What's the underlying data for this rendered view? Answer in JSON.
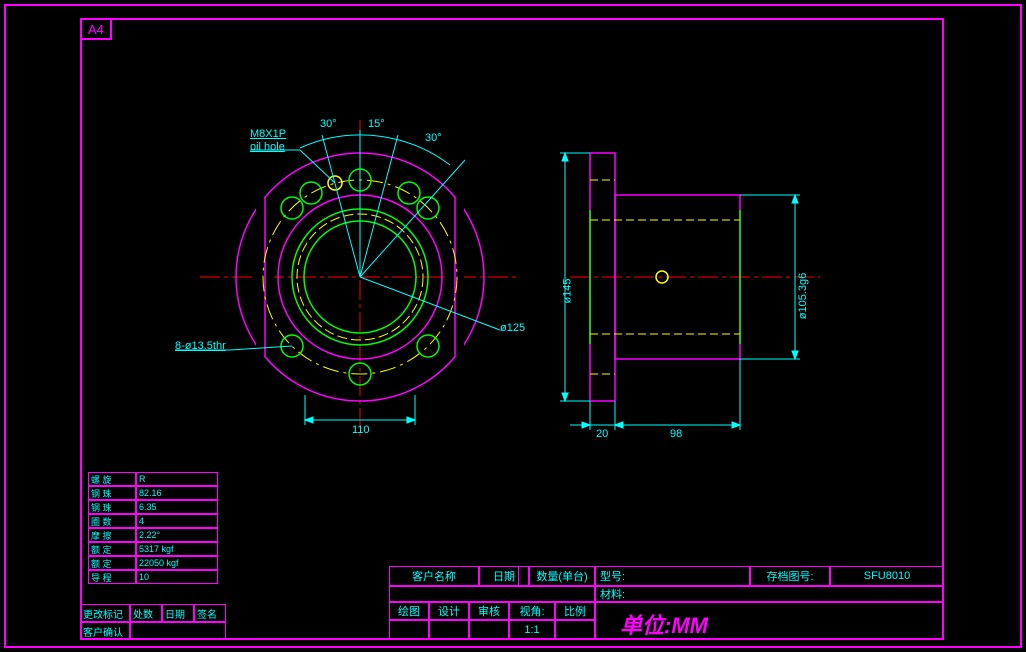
{
  "sheet_size": "A4",
  "drawing": {
    "oil_hole": "M8X1P",
    "oil_hole_label": "oil hole",
    "angles": {
      "a1": "30°",
      "a2": "15°",
      "a3": "30°"
    },
    "hole_callout": "8-ø13.5thr",
    "diam_bolt_circle": "ø125",
    "front_dims": {
      "width": "110"
    },
    "side_dims": {
      "height": "ø145",
      "outer_dia": "ø105.3g6",
      "flange": "20",
      "body": "98"
    }
  },
  "params": {
    "rows": [
      [
        "螺 旋",
        "R"
      ],
      [
        "钢 珠",
        "82.16"
      ],
      [
        "钢 珠",
        "6.35"
      ],
      [
        "圈 数",
        "4"
      ],
      [
        "摩 擦",
        "2.22°"
      ],
      [
        "额 定",
        "5317 kgf"
      ],
      [
        "额 定",
        "22050 kgf"
      ],
      [
        "导 程",
        "10"
      ]
    ]
  },
  "revision": {
    "h1": "更改标记",
    "h2": "处数",
    "h3": "日期",
    "h4": "签名",
    "h5": "客户确认"
  },
  "title_block": {
    "r1": [
      "客户名称",
      "",
      "日期",
      "数量(单台)",
      "型号:",
      "",
      "存档图号:",
      "SFU8010"
    ],
    "r2_material": "材料:",
    "r3": [
      "绘图",
      "设计",
      "审核",
      "视角:",
      "比例"
    ],
    "r4_scale": "1:1",
    "unit_label": "单位:MM"
  },
  "colors": {
    "magenta": "#f0f",
    "cyan": "#0ff",
    "green": "#0f0",
    "yellow": "#ff0",
    "red": "#f00"
  }
}
